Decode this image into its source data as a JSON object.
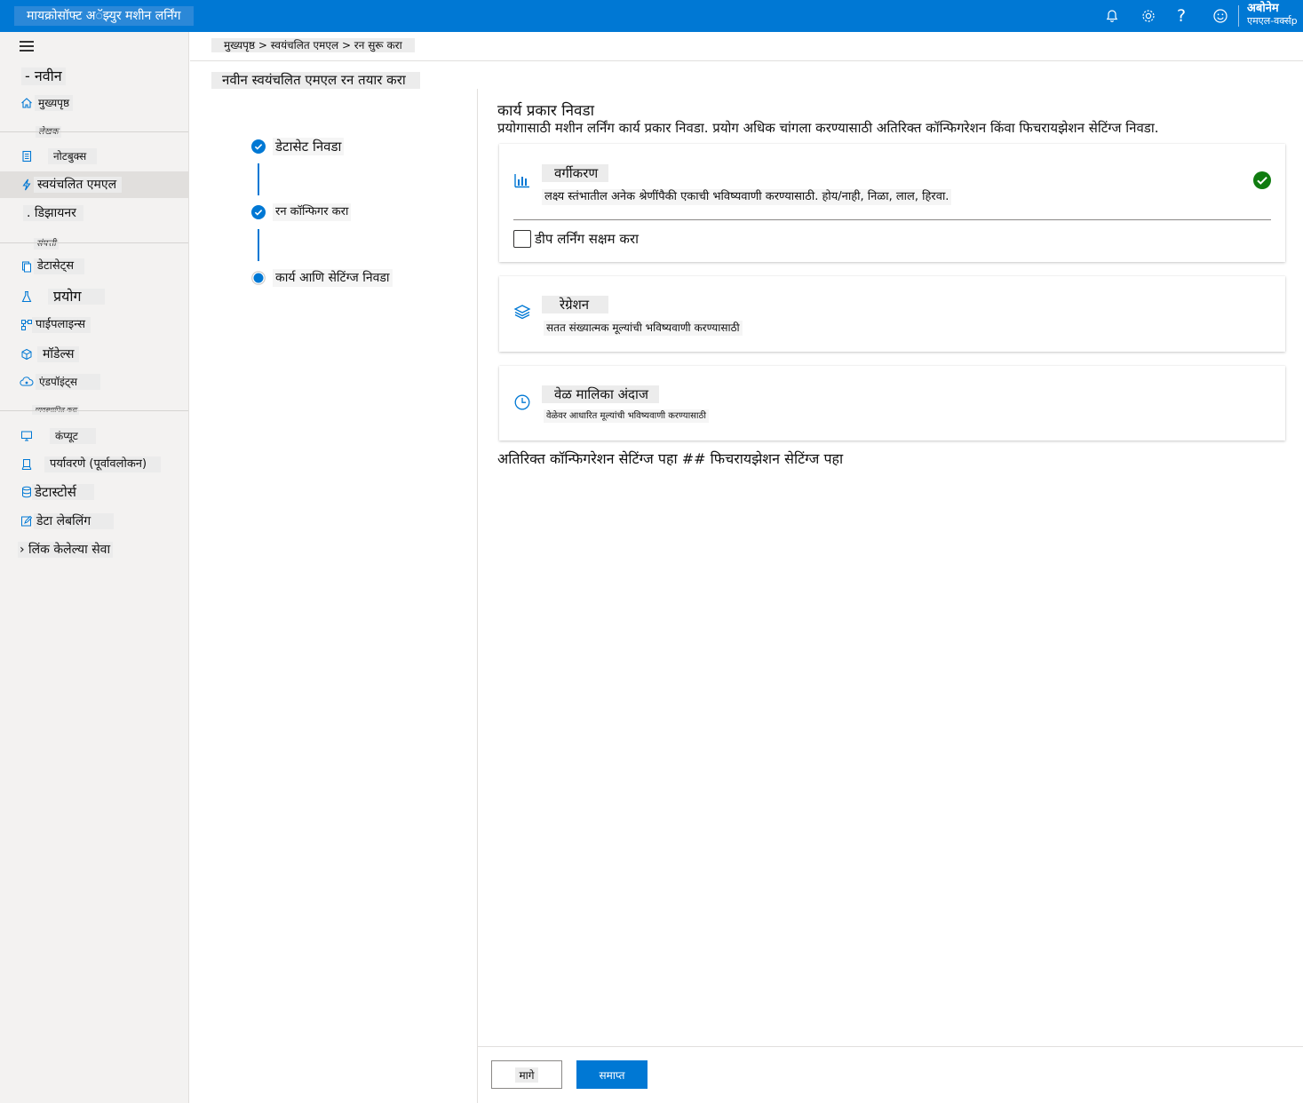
{
  "app": {
    "title": "मायक्रोसॉफ्ट अॅझ्युर मशीन लर्निंग",
    "user_name": "अबोनेम",
    "workspace": "एमएल-वर्क्सp"
  },
  "topbar_icons": [
    "bell-icon",
    "gear-icon",
    "help-icon",
    "smiley-icon"
  ],
  "topbar_help_glyph": "?",
  "sidebar": {
    "new_label": "- नवीन",
    "home": "मुख्यपृष्ठ",
    "section_author": "लेखक",
    "notebooks": "नोटबुक्स",
    "automl": "स्वयंचलित एमएल",
    "designer": ". डिझायनर",
    "section_assets": "संपत्ती",
    "datasets": "डेटासेट्स",
    "experiments": "प्रयोग",
    "pipelines": "पाईपलाइन्स",
    "models": "मॉडेल्स",
    "endpoints": "एंडपॉइंट्स",
    "section_manage": "व्यवस्थापित करा",
    "compute": "कंप्यूट",
    "environments": "पर्यावरणे (पूर्वावलोकन)",
    "datastores": "डेटास्टोर्स",
    "data_labeling": "डेटा लेबलिंग",
    "linked_services": "› लिंक केलेल्या सेवा"
  },
  "breadcrumb": "मुख्यपृष्ठ > स्वयंचलित एमएल > रन सुरू करा",
  "page_title": "नवीन स्वयंचलित एमएल रन तयार करा",
  "steps": [
    {
      "label": "डेटासेट निवडा",
      "state": "complete"
    },
    {
      "label": "रन कॉन्फिगर करा",
      "state": "complete"
    },
    {
      "label": "कार्य आणि सेटिंग्ज निवडा",
      "state": "current"
    }
  ],
  "task": {
    "title": "कार्य प्रकार निवडा",
    "description": "प्रयोगासाठी मशीन लर्निंग कार्य प्रकार निवडा. प्रयोग अधिक चांगला करण्यासाठी अतिरिक्त कॉन्फिगरेशन किंवा फिचरायझेशन सेटिंग्ज निवडा.",
    "cards": [
      {
        "name": "वर्गीकरण",
        "description": "लक्ष्य स्तंभातील अनेक श्रेणींपैकी एकाची भविष्यवाणी करण्यासाठी. होय/नाही, निळा, लाल, हिरवा.",
        "icon": "bar-chart-icon",
        "selected": true
      },
      {
        "name": "रेग्रेशन",
        "description": "सतत संख्यात्मक मूल्यांची भविष्यवाणी करण्यासाठी",
        "icon": "layers-icon",
        "selected": false
      },
      {
        "name": "वेळ मालिका अंदाज",
        "description": "वेळेवर आधारित मूल्यांची भविष्यवाणी करण्यासाठी",
        "icon": "clock-icon",
        "selected": false
      }
    ],
    "deep_learning_label": "डीप लर्निंग सक्षम करा",
    "deep_learning_checked": false,
    "extra_settings": "अतिरिक्त कॉन्फिगरेशन सेटिंग्ज पहा ## फिचरायझेशन सेटिंग्ज पहा"
  },
  "buttons": {
    "back": "मागे",
    "finish": "समाप्त"
  },
  "colors": {
    "accent": "#0078d4",
    "success": "#107c10"
  }
}
